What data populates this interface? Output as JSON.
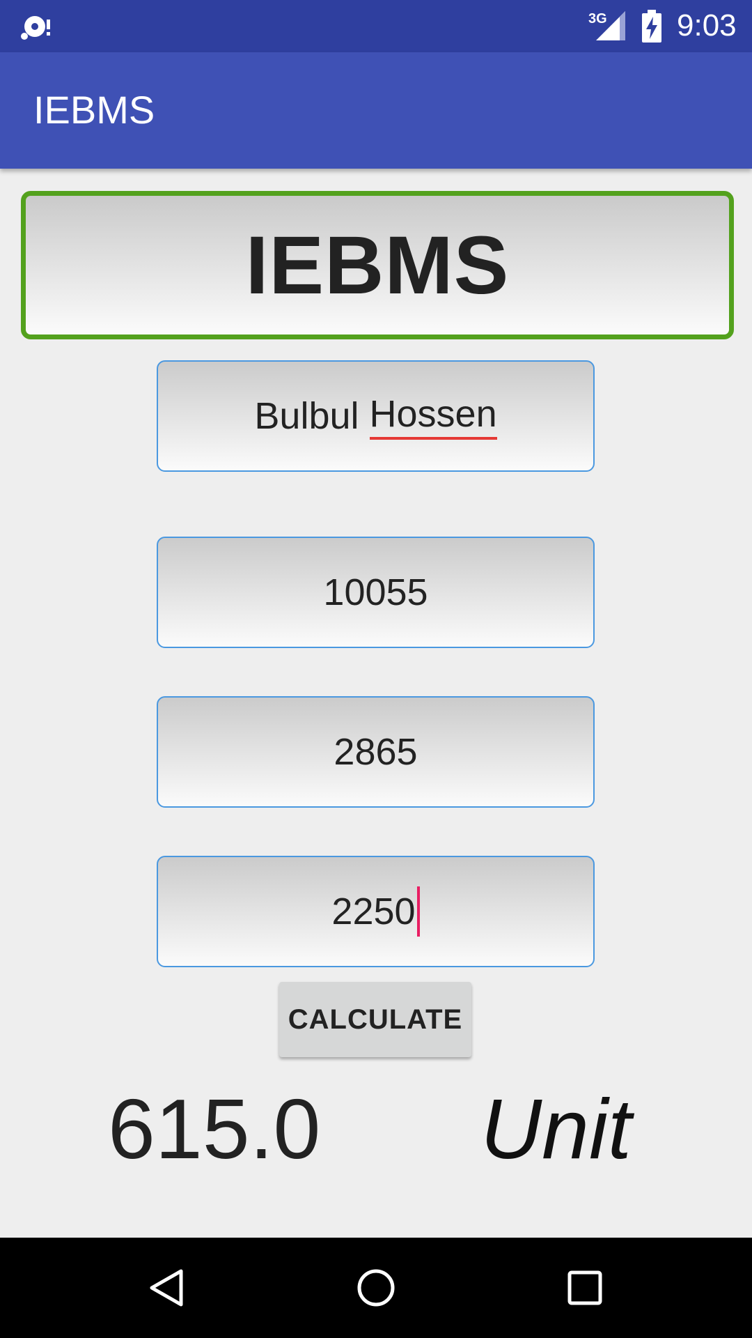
{
  "status_bar": {
    "network_label": "3G",
    "time": "9:03",
    "icons": [
      "sync-notification-icon",
      "signal-icon",
      "battery-charging-icon"
    ]
  },
  "app_bar": {
    "title": "IEBMS"
  },
  "header": {
    "title": "IEBMS",
    "border_color": "#53a11d"
  },
  "form": {
    "name_first": "Bulbul",
    "name_last": "Hossen",
    "field_a_value": "10055",
    "field_b_value": "2865",
    "field_c_value": "2250",
    "calculate_label": "CALCULATE"
  },
  "result": {
    "value": "615.0",
    "unit": "Unit"
  },
  "navigation": {
    "icons": [
      "back-icon",
      "home-icon",
      "recents-icon"
    ]
  },
  "colors": {
    "status_bar": "#2f3f9f",
    "app_bar": "#3f51b5",
    "field_border": "#4a98e0",
    "caret": "#e91e63",
    "spellcheck_underline": "#e53935"
  }
}
